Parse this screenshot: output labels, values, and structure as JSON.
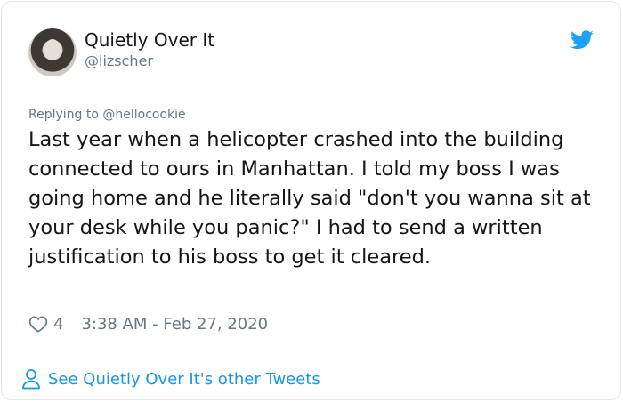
{
  "tweet": {
    "author_name": "Quietly Over It",
    "author_handle": "@lizscher",
    "replying_prefix": "Replying to ",
    "replying_to": "@hellocookie",
    "text": "Last year when a helicopter crashed into the building connected to ours in Manhattan. I told my boss I was going home and he literally said \"don't you wanna sit at your desk while you panic?\" I had to send a written justification to his boss to get it cleared.",
    "like_count": "4",
    "timestamp": "3:38 AM - Feb 27, 2020"
  },
  "footer": {
    "link_text": "See Quietly Over It's other Tweets"
  },
  "colors": {
    "twitter_blue": "#1da1f2",
    "link_blue": "#1b95e0",
    "secondary_text": "#657786",
    "primary_text": "#14171a",
    "border": "#e1e8ed"
  },
  "icons": {
    "brand": "twitter-bird-icon",
    "like": "heart-outline-icon",
    "profile": "person-outline-icon"
  }
}
